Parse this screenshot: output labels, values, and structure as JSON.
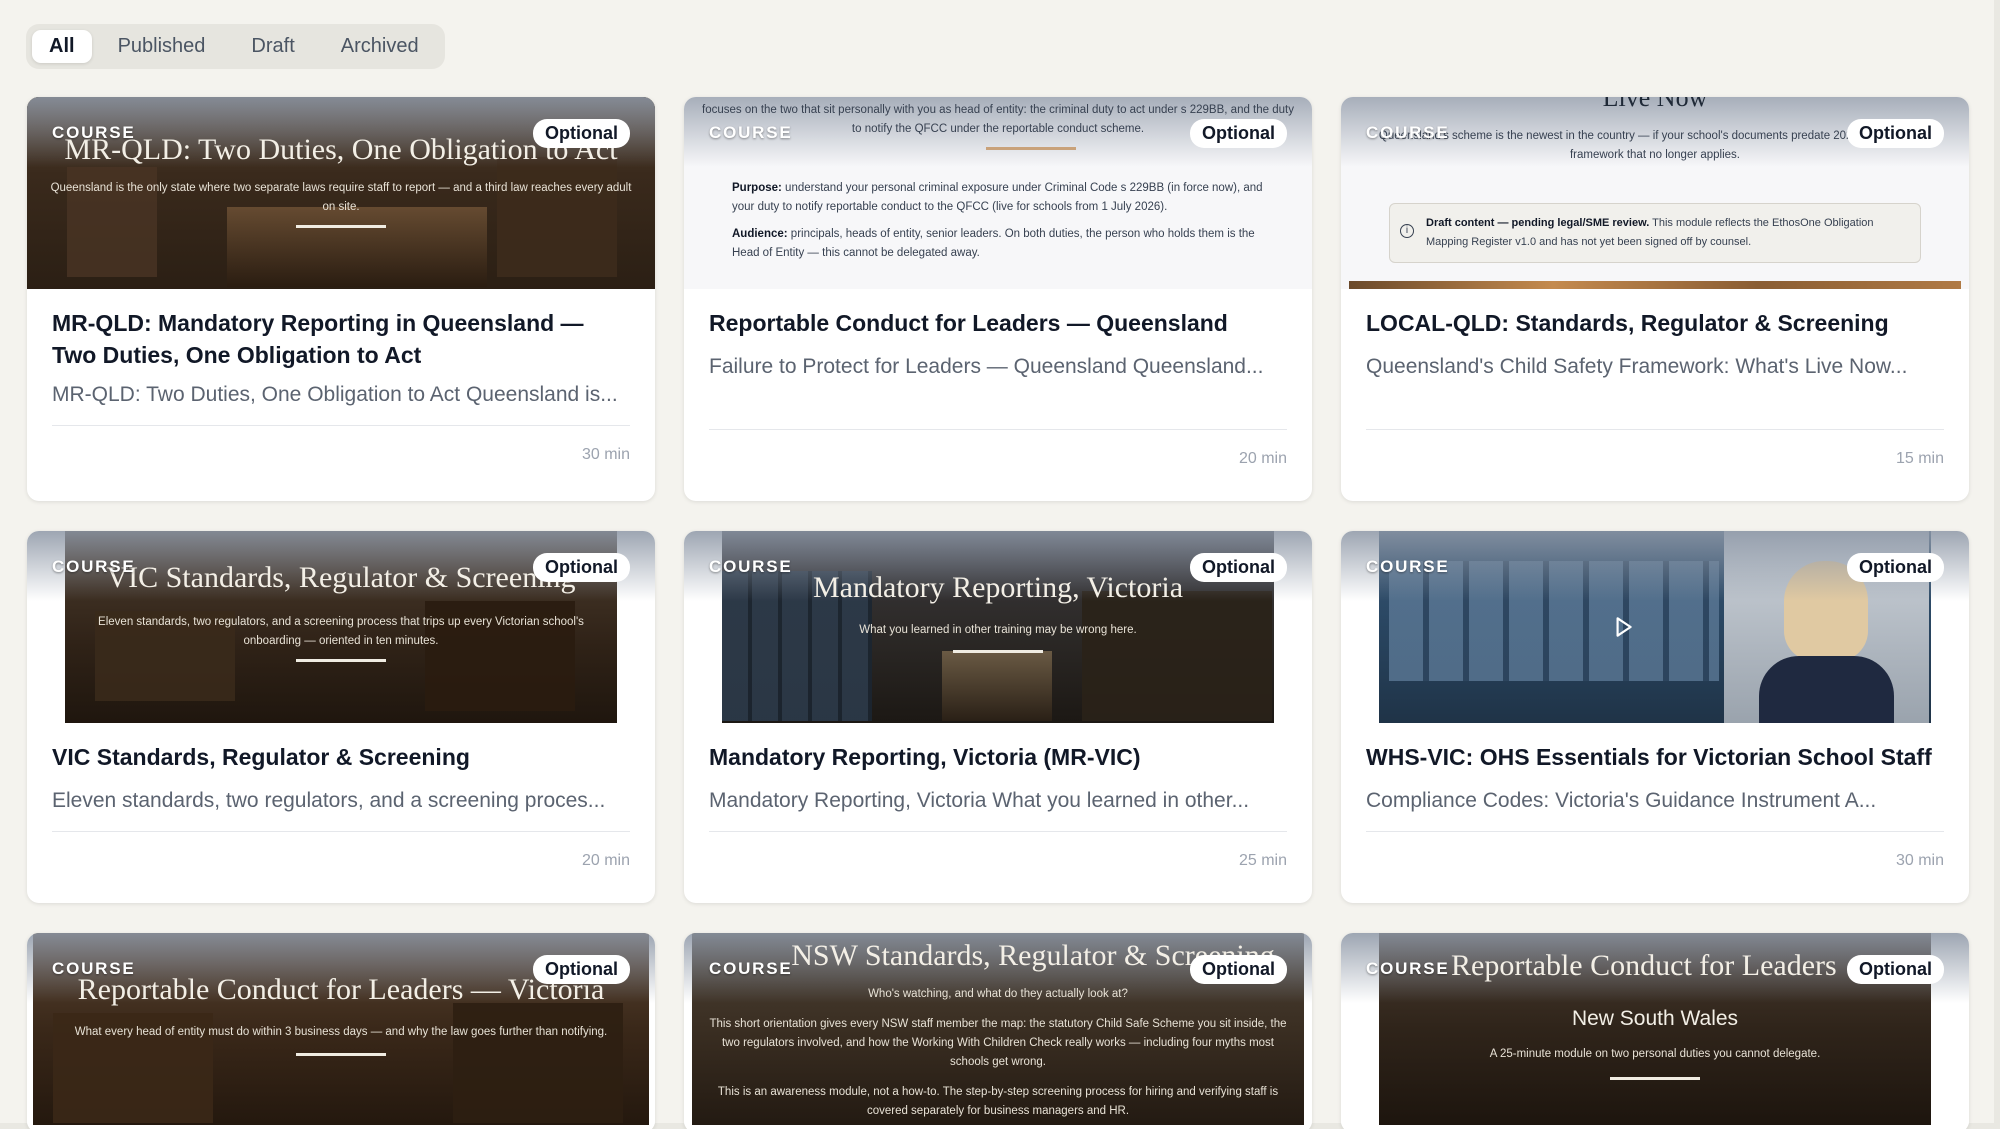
{
  "tabs": [
    "All",
    "Published",
    "Draft",
    "Archived"
  ],
  "active_tab": "All",
  "cards": [
    {
      "tag": "COURSE",
      "badge": "Optional",
      "slide_title": "MR-QLD: Two Duties, One Obligation to Act",
      "slide_sub": "Queensland is the only state where two separate laws require staff to report — and a third law reaches every adult on site.",
      "title": "MR-QLD: Mandatory Reporting in Queensland — Two Duties, One Obligation to Act",
      "desc": "MR-QLD: Two Duties, One Obligation to Act Queensland is...",
      "duration": "30 min"
    },
    {
      "tag": "COURSE",
      "badge": "Optional",
      "doc_intro": "focuses on the two that sit personally with you as head of entity: the criminal duty to act under s 229BB, and the duty to notify the QFCC under the reportable conduct scheme.",
      "doc_purpose_label": "Purpose:",
      "doc_purpose": "understand your personal criminal exposure under Criminal Code s 229BB (in force now), and your duty to notify reportable conduct to the QFCC (live for schools from 1 July 2026).",
      "doc_audience_label": "Audience:",
      "doc_audience": "principals, heads of entity, senior leaders. On both duties, the person who holds them is the Head of Entity — this cannot be delegated away.",
      "title": "Reportable Conduct for Leaders — Queensland",
      "desc": "Failure to Protect for Leaders — Queensland Queensland...",
      "duration": "20 min"
    },
    {
      "tag": "COURSE",
      "badge": "Optional",
      "slide_title": "Live Now",
      "slide_sub": "Queensland's scheme is the newest in the country — if your school's documents predate 2025, they reflect a framework that no longer applies.",
      "note_bold": "Draft content — pending legal/SME review.",
      "note": "This module reflects the EthosOne Obligation Mapping Register v1.0 and has not yet been signed off by counsel.",
      "title": "LOCAL-QLD: Standards, Regulator & Screening",
      "desc": "Queensland's Child Safety Framework: What's Live Now...",
      "duration": "15 min"
    },
    {
      "tag": "COURSE",
      "badge": "Optional",
      "slide_title": "VIC Standards, Regulator & Screening",
      "slide_sub": "Eleven standards, two regulators, and a screening process that trips up every Victorian school's onboarding — oriented in ten minutes.",
      "title": "VIC Standards, Regulator & Screening",
      "desc": "Eleven standards, two regulators, and a screening proces...",
      "duration": "20 min"
    },
    {
      "tag": "COURSE",
      "badge": "Optional",
      "slide_title": "Mandatory Reporting, Victoria",
      "slide_sub": "What you learned in other training may be wrong here.",
      "title": "Mandatory Reporting, Victoria (MR-VIC)",
      "desc": "Mandatory Reporting, Victoria What you learned in other...",
      "duration": "25 min"
    },
    {
      "tag": "COURSE",
      "badge": "Optional",
      "title": "WHS-VIC: OHS Essentials for Victorian School Staff",
      "desc": "Compliance Codes: Victoria's Guidance Instrument A...",
      "duration": "30 min"
    },
    {
      "tag": "COURSE",
      "badge": "Optional",
      "slide_title": "Reportable Conduct for Leaders — Victoria",
      "slide_sub": "What every head of entity must do within 3 business days — and why the law goes further than notifying."
    },
    {
      "tag": "COURSE",
      "badge": "Optional",
      "slide_title": "NSW Standards, Regulator & Screening",
      "slide_sub": "Who's watching, and what do they actually look at?",
      "slide_sub2": "This short orientation gives every NSW staff member the map: the statutory Child Safe Scheme you sit inside, the two regulators involved, and how the Working With Children Check really works — including four myths most schools get wrong.",
      "slide_sub3": "This is an awareness module, not a how-to. The step-by-step screening process for hiring and verifying staff is covered separately for business managers and HR."
    },
    {
      "tag": "COURSE",
      "badge": "Optional",
      "slide_title": "Reportable Conduct for Leaders",
      "slide_title2": "New South Wales",
      "slide_sub": "A 25-minute module on two personal duties you cannot delegate."
    }
  ],
  "colors": {
    "accent_rule": "#c9a27a",
    "page_bg": "#f4f3ee"
  }
}
